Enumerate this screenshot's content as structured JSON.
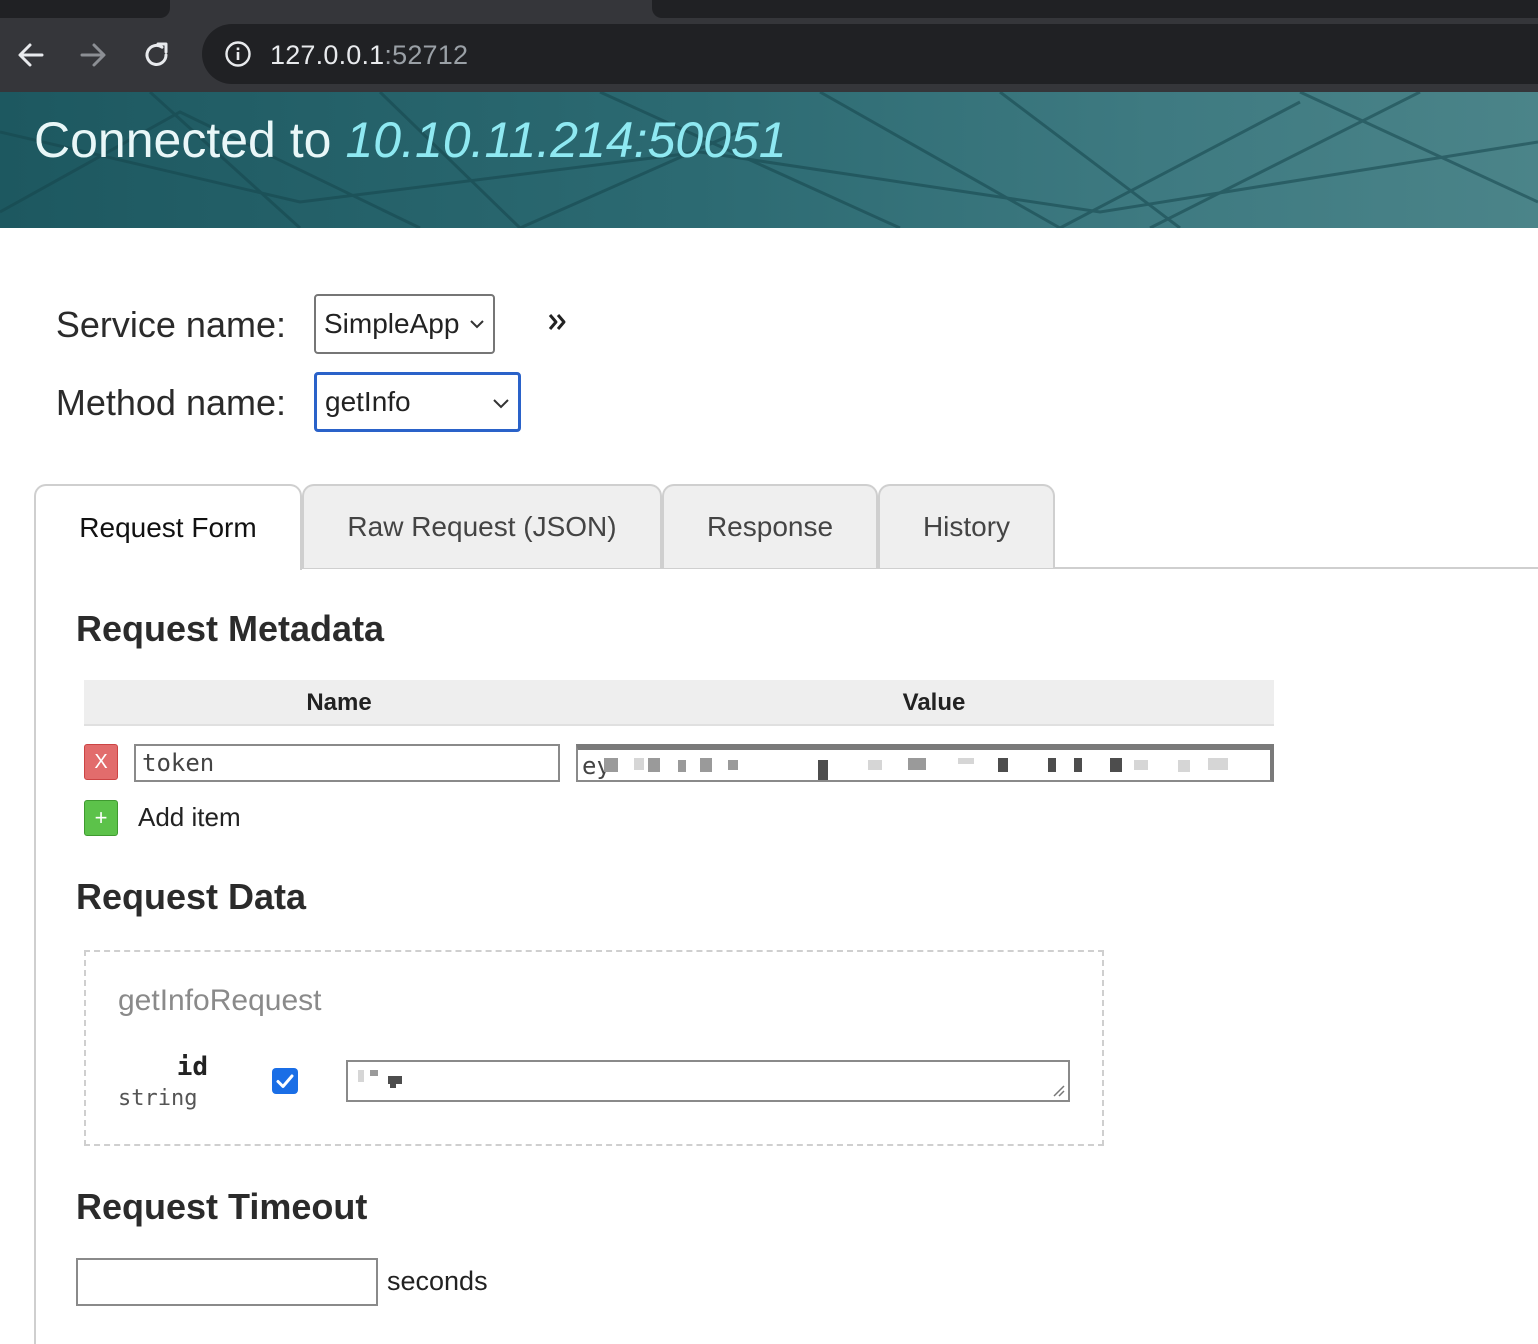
{
  "browser": {
    "url_host": "127.0.0.1",
    "url_port": ":52712"
  },
  "banner": {
    "label": "Connected to",
    "host": "10.10.11.214:50051"
  },
  "service": {
    "label": "Service name:",
    "selected": "SimpleApp"
  },
  "method": {
    "label": "Method name:",
    "selected": "getInfo"
  },
  "tabs": [
    {
      "label": "Request Form",
      "active": true
    },
    {
      "label": "Raw Request (JSON)",
      "active": false
    },
    {
      "label": "Response",
      "active": false
    },
    {
      "label": "History",
      "active": false
    }
  ],
  "metadata": {
    "title": "Request Metadata",
    "col_name": "Name",
    "col_value": "Value",
    "rows": [
      {
        "remove_label": "X",
        "name": "token",
        "value_prefix": "ey"
      }
    ],
    "add_label": "+",
    "add_text": "Add item"
  },
  "request_data": {
    "title": "Request Data",
    "message": "getInfoRequest",
    "fields": [
      {
        "name": "id",
        "type": "string",
        "checked": true
      }
    ]
  },
  "timeout": {
    "title": "Request Timeout",
    "value": "",
    "unit": "seconds"
  },
  "colors": {
    "banner": "#2c6a72",
    "host_text": "#8fe9f2",
    "remove_button": "#e26c6c",
    "add_button": "#5cc24a",
    "checkbox": "#1a6ee6",
    "focus_border": "#2a62c9"
  }
}
